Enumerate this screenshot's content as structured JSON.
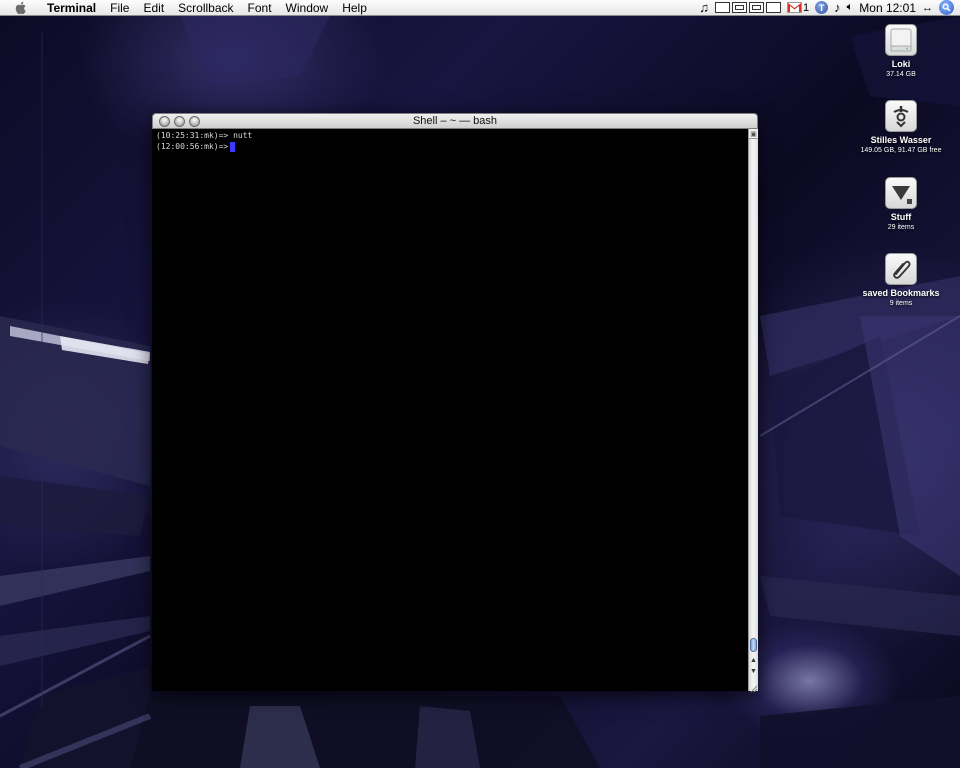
{
  "menubar": {
    "app_name": "Terminal",
    "items": [
      {
        "label": "File"
      },
      {
        "label": "Edit"
      },
      {
        "label": "Scrollback"
      },
      {
        "label": "Font"
      },
      {
        "label": "Window"
      },
      {
        "label": "Help"
      }
    ],
    "gmail_count": "1",
    "status_t_icon_letter": "T",
    "clock": "Mon 12:01",
    "fastswitch_glyph": "<·>"
  },
  "window": {
    "title": "Shell – ~ — bash",
    "lines": [
      {
        "text": "(10:25:31:mk)=> nutt"
      },
      {
        "text": "(12:00:56:mk)=>"
      }
    ],
    "cursor_color": "#3e38ff"
  },
  "desktop_icons": [
    {
      "name": "Loki",
      "detail": "37.14 GB",
      "icon": "drive-icon"
    },
    {
      "name": "Stilles Wasser",
      "detail": "149.05 GB, 91.47 GB free",
      "icon": "firewire-drive-icon"
    },
    {
      "name": "Stuff",
      "detail": "29 items",
      "icon": "stuff-folder-icon"
    },
    {
      "name": "saved Bookmarks",
      "detail": "9 items",
      "icon": "paperclip-icon"
    }
  ],
  "colors": {
    "menubar_bg": "#eeeeee",
    "terminal_bg": "#000000",
    "terminal_text": "#d8d8d8",
    "gmail_red": "#d93025",
    "spotlight_blue": "#2b5fc7"
  }
}
